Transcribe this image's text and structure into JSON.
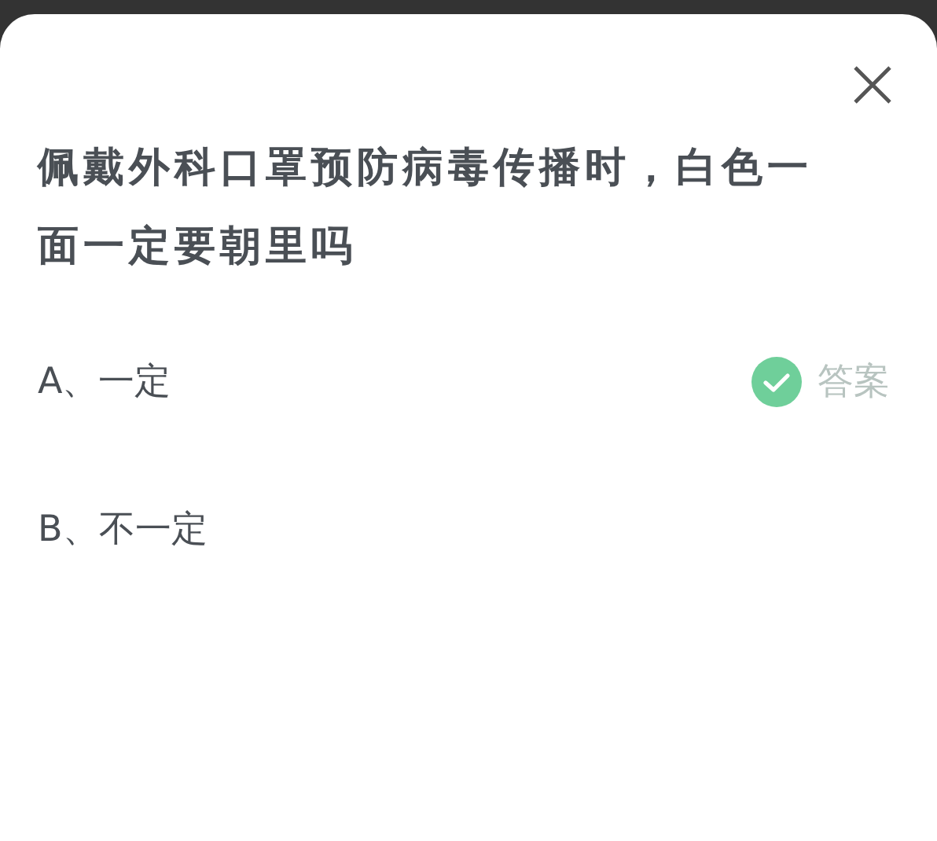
{
  "question": "佩戴外科口罩预防病毒传播时，白色一面一定要朝里吗",
  "options": [
    {
      "label": "A、一定",
      "correct": true,
      "badge": "答案"
    },
    {
      "label": "B、不一定",
      "correct": false
    }
  ]
}
